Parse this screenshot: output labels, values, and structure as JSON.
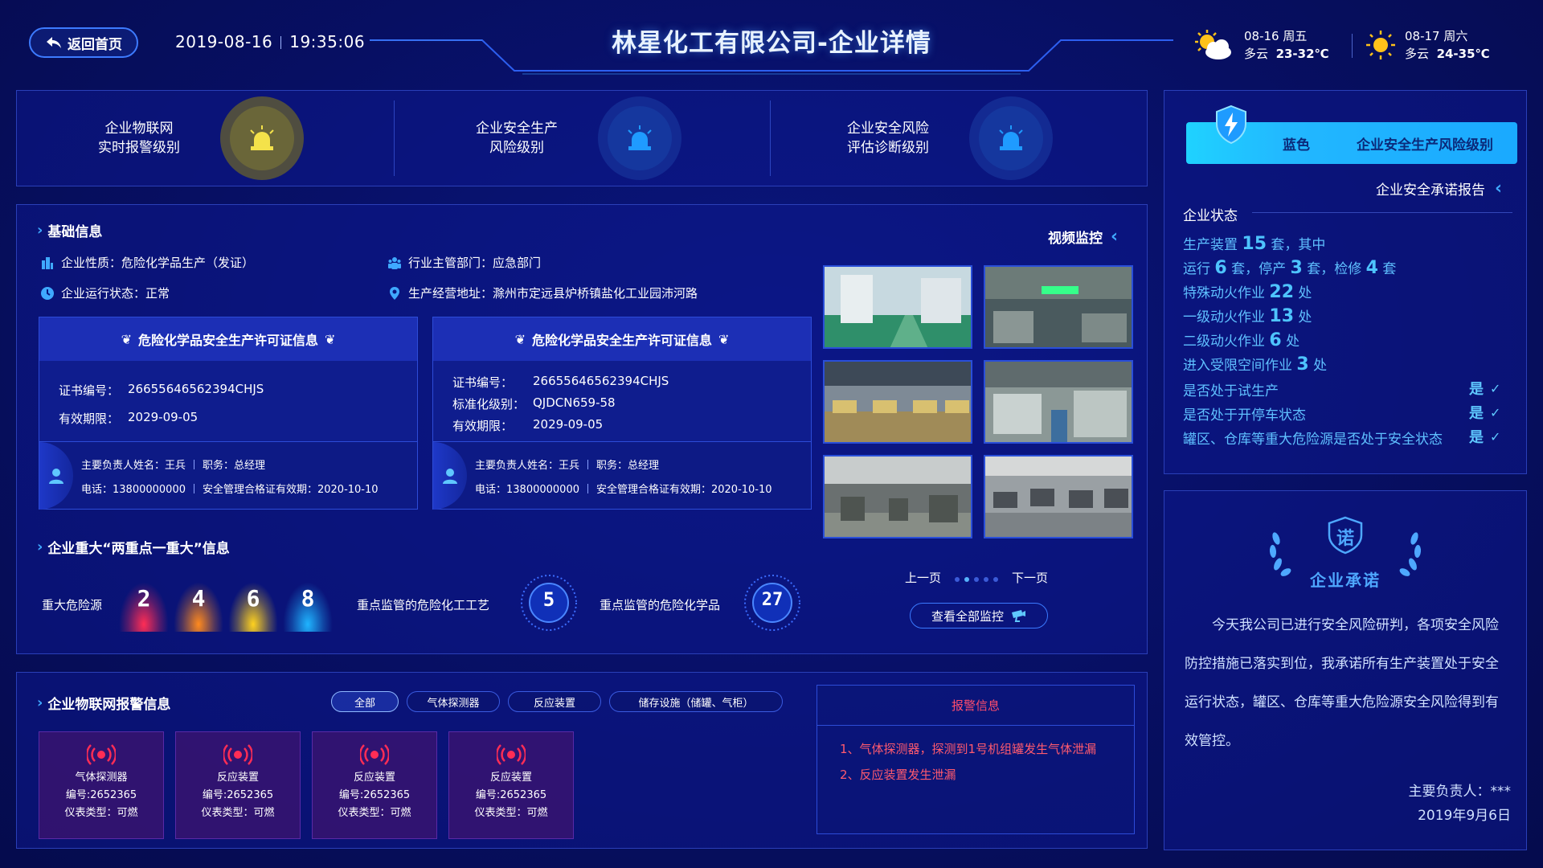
{
  "header": {
    "back_label": "返回首页",
    "date": "2019-08-16",
    "time": "19:35:06",
    "title": "林星化工有限公司-企业详情",
    "weather": [
      {
        "date": "08-16 周五",
        "desc": "多云",
        "temp": "23-32℃",
        "icon": "sun-cloud-icon"
      },
      {
        "date": "08-17 周六",
        "desc": "多云",
        "temp": "24-35℃",
        "icon": "sun-icon"
      }
    ]
  },
  "levels": [
    {
      "line1": "企业物联网",
      "line2": "实时报警级别",
      "color": "#f4e24a",
      "ring": "#6e6a3a"
    },
    {
      "line1": "企业安全生产",
      "line2": "风险级别",
      "color": "#1f8bff",
      "ring": "#1a3aa6"
    },
    {
      "line1": "企业安全风险",
      "line2": "评估诊断级别",
      "color": "#1f8bff",
      "ring": "#1a3aa6"
    }
  ],
  "basic": {
    "title": "基础信息",
    "nature": "企业性质：危险化学品生产（发证）",
    "dept": "行业主管部门：应急部门",
    "status": "企业运行状态：正常",
    "address": "生产经营地址：滁州市定远县炉桥镇盐化工业园沛河路"
  },
  "certs": [
    {
      "title": "危险化学品安全生产许可证信息",
      "rows": [
        {
          "k": "证书编号：",
          "v": "26655646562394CHJS"
        },
        {
          "k": "有效期限：",
          "v": "2029-09-05"
        }
      ],
      "manager": "主要负责人姓名：王兵",
      "position": "职务：总经理",
      "phone": "电话：13800000000",
      "cert_valid": "安全管理合格证有效期：2020-10-10"
    },
    {
      "title": "危险化学品安全生产许可证信息",
      "rows": [
        {
          "k": "证书编号：",
          "v": "26655646562394CHJS"
        },
        {
          "k": "标准化级别：",
          "v": "QJDCN659-58"
        },
        {
          "k": "有效期限：",
          "v": "2029-09-05"
        }
      ],
      "manager": "主要负责人姓名：王兵",
      "position": "职务：总经理",
      "phone": "电话：13800000000",
      "cert_valid": "安全管理合格证有效期：2020-10-10"
    }
  ],
  "major": {
    "title": "企业重大“两重点一重大”信息",
    "hazard_label": "重大危险源",
    "hazard_values": [
      {
        "v": "2",
        "color": "#ff2d55"
      },
      {
        "v": "4",
        "color": "#ff8a1e"
      },
      {
        "v": "6",
        "color": "#ffd21e"
      },
      {
        "v": "8",
        "color": "#1fb4ff"
      }
    ],
    "process_label": "重点监管的危险化工工艺",
    "process_value": "5",
    "chem_label": "重点监管的危险化学品",
    "chem_value": "27"
  },
  "video": {
    "title": "视频监控",
    "prev": "上一页",
    "next": "下一页",
    "view_all": "查看全部监控"
  },
  "iot": {
    "title": "企业物联网报警信息",
    "filters": [
      "全部",
      "气体探测器",
      "反应装置",
      "储存设施（储罐、气柜）"
    ],
    "cards": [
      {
        "name": "气体探测器",
        "code": "编号:2652365",
        "type": "仪表类型：可燃"
      },
      {
        "name": "反应装置",
        "code": "编号:2652365",
        "type": "仪表类型：可燃"
      },
      {
        "name": "反应装置",
        "code": "编号:2652365",
        "type": "仪表类型：可燃"
      },
      {
        "name": "反应装置",
        "code": "编号:2652365",
        "type": "仪表类型：可燃"
      }
    ],
    "alarm_title": "报警信息",
    "alarm_msgs": [
      "1、气体探测器，探测到1号机组罐发生气体泄漏",
      "2、反应装置发生泄漏"
    ]
  },
  "right": {
    "risk_level": "蓝色",
    "risk_text": "企业安全生产风险级别",
    "promise_report": "企业安全承诺报告",
    "status_title": "企业状态",
    "lines": [
      {
        "pre": "生产装置 ",
        "num": "15",
        "post": " 套，其中"
      },
      {
        "pre": "运行 ",
        "num": "6",
        "mid": " 套，停产 ",
        "num2": "3",
        "mid2": " 套，检修 ",
        "num3": "4",
        "post": " 套"
      },
      {
        "pre": "特殊动火作业 ",
        "num": "22",
        "post": " 处"
      },
      {
        "pre": "一级动火作业 ",
        "num": "13",
        "post": " 处"
      },
      {
        "pre": "二级动火作业 ",
        "num": "6",
        "post": " 处"
      },
      {
        "pre": "进入受限空间作业 ",
        "num": "3",
        "post": " 处"
      }
    ],
    "checks": [
      {
        "label": "是否处于试生产",
        "value": "是"
      },
      {
        "label": "是否处于开停车状态",
        "value": "是"
      },
      {
        "label": "罐区、仓库等重大危险源是否处于安全状态",
        "value": "是"
      }
    ],
    "promise_badge": "诺",
    "promise_title": "企业承诺",
    "promise_text": "今天我公司已进行安全风险研判，各项安全风险防控措施已落实到位，我承诺所有生产装置处于安全运行状态，罐区、仓库等重大危险源安全风险得到有效管控。",
    "signer": "主要负责人：***",
    "sign_date": "2019年9月6日"
  }
}
